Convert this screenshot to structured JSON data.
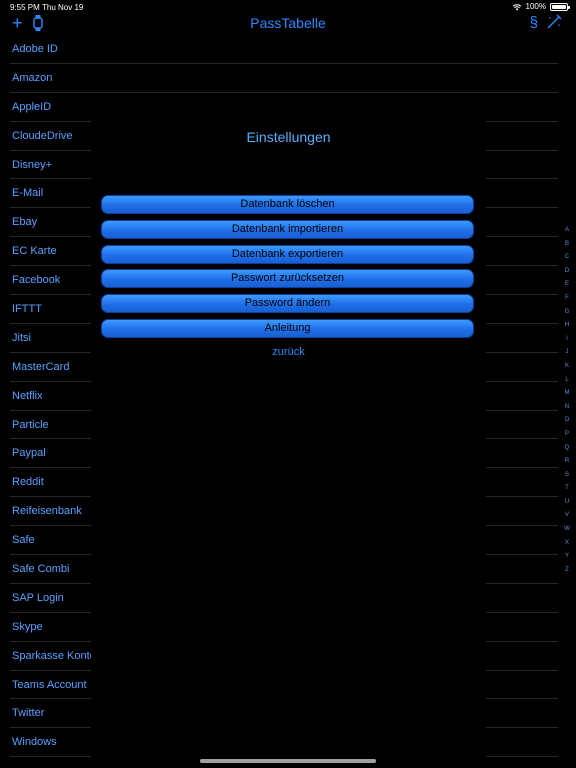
{
  "status": {
    "time": "9:55 PM",
    "date": "Thu Nov 19",
    "battery": "100%",
    "battery_level": 1.0
  },
  "nav": {
    "title": "PassTabelle",
    "add_icon": "plus-icon",
    "watch_icon": "watch-icon",
    "section_label": "§",
    "tool_icon": "wand-icon"
  },
  "list": {
    "items": [
      "Adobe ID",
      "Amazon",
      "AppleID",
      "CloudeDrive",
      "Disney+",
      "E-Mail",
      "Ebay",
      "EC Karte",
      "Facebook",
      "IFTTT",
      "Jitsi",
      "MasterCard",
      "Netflix",
      "Particle",
      "Paypal",
      "Reddit",
      "Reifeisenbank",
      "Safe",
      "Safe Combi",
      "SAP Login",
      "Skype",
      "Sparkasse Konto",
      "Teams Account",
      "Twitter",
      "Windows"
    ]
  },
  "index": [
    "A",
    "B",
    "C",
    "D",
    "E",
    "F",
    "G",
    "H",
    "I",
    "J",
    "K",
    "L",
    "M",
    "N",
    "O",
    "P",
    "Q",
    "R",
    "S",
    "T",
    "U",
    "V",
    "W",
    "X",
    "Y",
    "Z"
  ],
  "modal": {
    "title": "Einstellungen",
    "buttons": [
      "Datenbank löschen",
      "Datenbank importieren",
      "Datenbank exportieren",
      "Passwort zurücksetzen",
      "Password ändern",
      "Anleitung"
    ],
    "back_label": "zurück"
  },
  "colors": {
    "accent": "#2a89ff",
    "button": "#1e6fe8",
    "background": "#000000"
  }
}
